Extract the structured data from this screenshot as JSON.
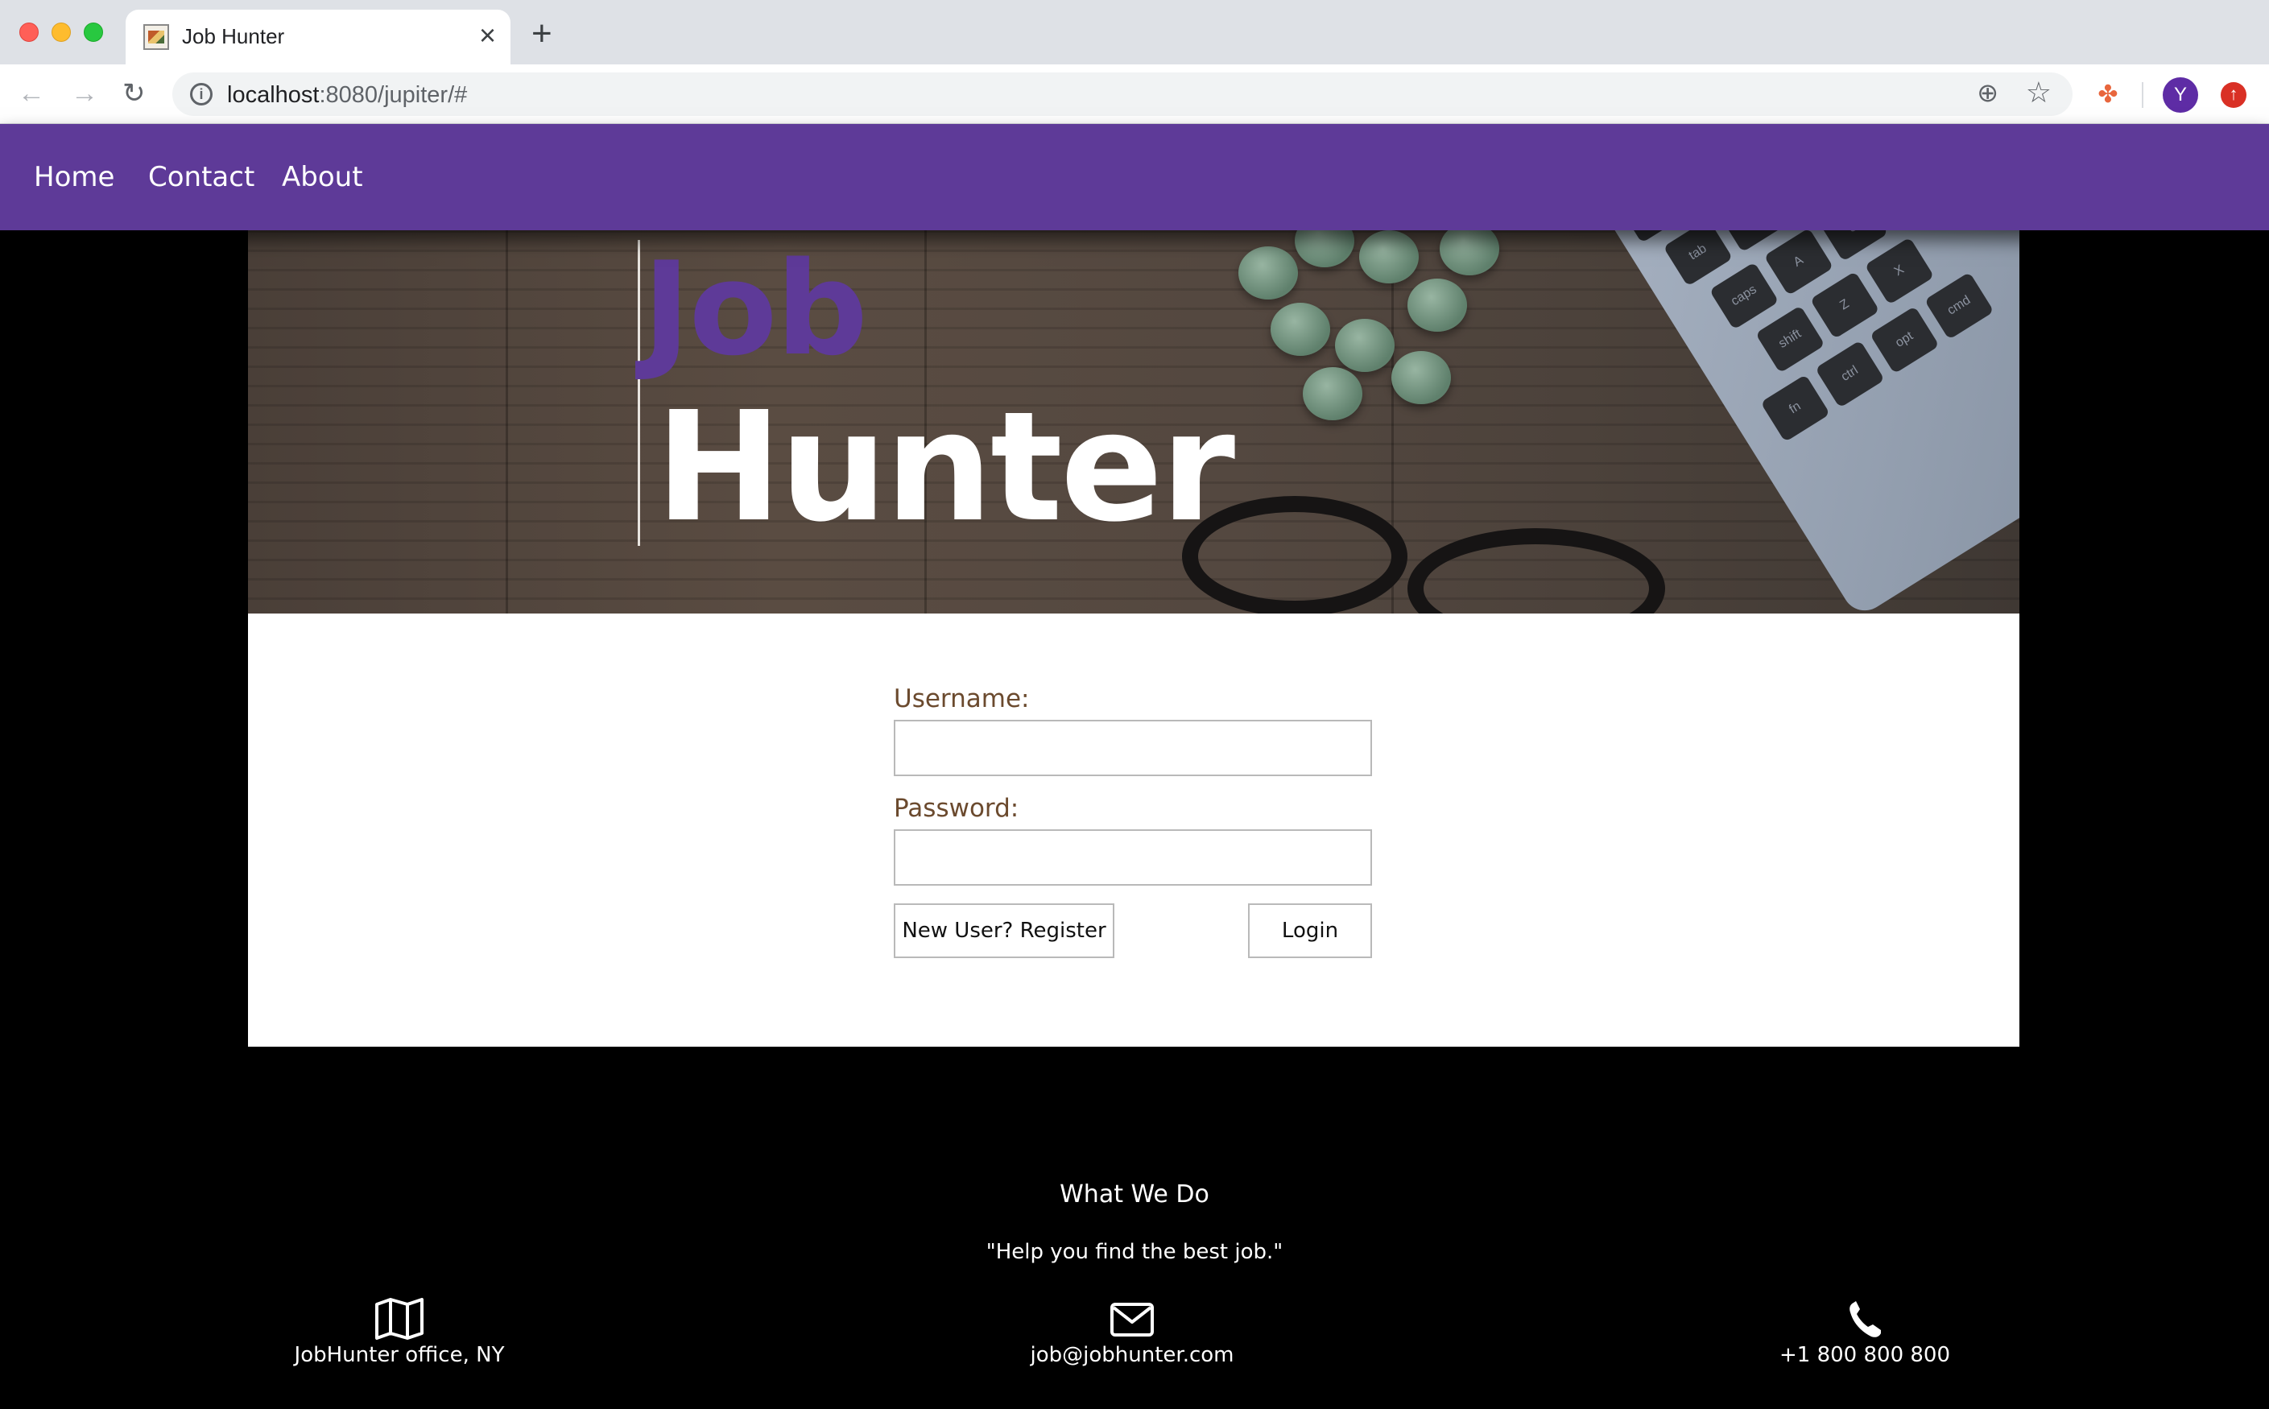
{
  "browser": {
    "tab_title": "Job Hunter",
    "tab_close": "×",
    "new_tab": "+",
    "url_host": "localhost",
    "url_rest": ":8080/jupiter/#",
    "avatar_letter": "Y",
    "icons": [
      "back-arrow-icon",
      "forward-arrow-icon",
      "reload-icon",
      "info-icon",
      "zoom-icon",
      "star-icon",
      "extension-icon",
      "profile-avatar",
      "update-icon"
    ]
  },
  "nav": {
    "items": [
      {
        "label": "Home"
      },
      {
        "label": "Contact"
      },
      {
        "label": "About"
      }
    ],
    "color": "#5e3a98"
  },
  "hero": {
    "title_top": "Job",
    "title_bottom": "Hunter",
    "accent": "#5e3a98"
  },
  "login": {
    "username_label": "Username:",
    "username_value": "",
    "password_label": "Password:",
    "password_value": "",
    "register_button": "New User? Register",
    "login_button": "Login"
  },
  "footer": {
    "title": "What We Do",
    "tagline": "\"Help you find the best job.\"",
    "items": [
      {
        "icon": "map-icon",
        "text": "JobHunter office, NY"
      },
      {
        "icon": "envelope-icon",
        "text": "job@jobhunter.com"
      },
      {
        "icon": "phone-icon",
        "text": "+1 800 800 800"
      }
    ]
  }
}
